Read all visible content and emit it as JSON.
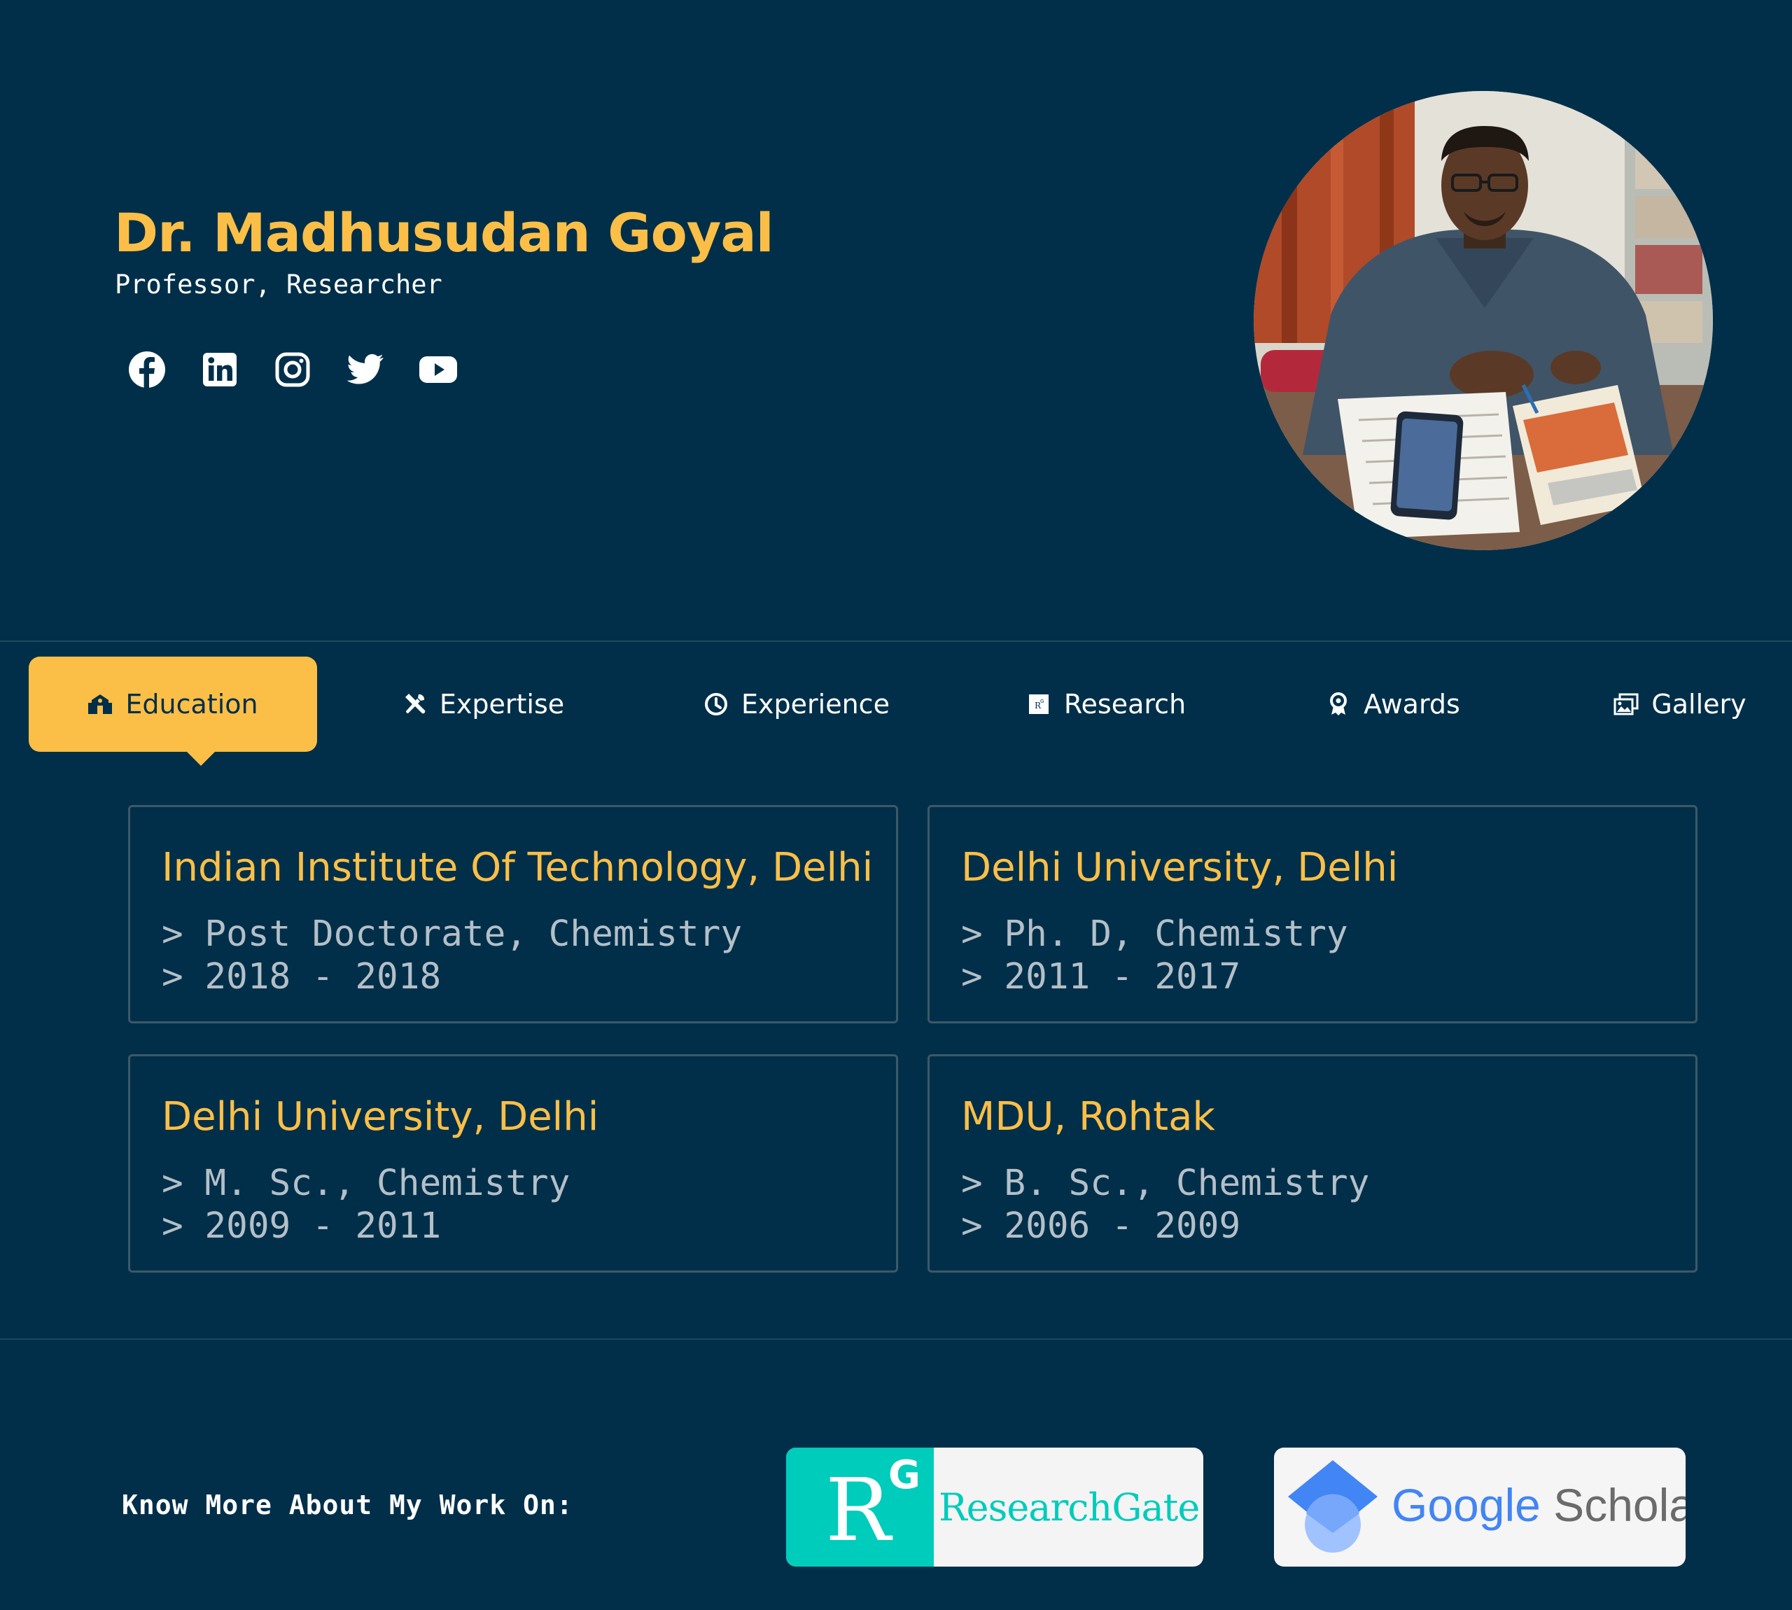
{
  "profile": {
    "name": "Dr. Madhusudan Goyal",
    "role": "Professor, Researcher",
    "photo_alt": "Profile photo"
  },
  "socials": [
    {
      "icon": "facebook-icon"
    },
    {
      "icon": "linkedin-icon"
    },
    {
      "icon": "instagram-icon"
    },
    {
      "icon": "twitter-icon"
    },
    {
      "icon": "youtube-icon"
    }
  ],
  "tabs": [
    {
      "label": "Education",
      "icon": "school-icon",
      "active": true
    },
    {
      "label": "Expertise",
      "icon": "tools-icon",
      "active": false
    },
    {
      "label": "Experience",
      "icon": "clock-icon",
      "active": false
    },
    {
      "label": "Research",
      "icon": "research-icon",
      "active": false
    },
    {
      "label": "Awards",
      "icon": "award-icon",
      "active": false
    },
    {
      "label": "Gallery",
      "icon": "gallery-icon",
      "active": false
    }
  ],
  "education": [
    {
      "institution": "Indian Institute Of Technology, Delhi",
      "degree": "> Post Doctorate, Chemistry",
      "years": "> 2018 - 2018"
    },
    {
      "institution": "Delhi University, Delhi",
      "degree": "> Ph. D, Chemistry",
      "years": "> 2011 - 2017"
    },
    {
      "institution": "Delhi University, Delhi",
      "degree": "> M. Sc., Chemistry",
      "years": "> 2009 - 2011"
    },
    {
      "institution": "MDU, Rohtak",
      "degree": "> B. Sc., Chemistry",
      "years": "> 2006 - 2009"
    }
  ],
  "footer": {
    "know_more": "Know More About My Work On:",
    "researchgate": {
      "mark_r": "R",
      "mark_g": "G",
      "label": "ResearchGate"
    },
    "scholar": {
      "google": "Google",
      "scholar": "Scholar"
    }
  },
  "colors": {
    "background": "#012f49",
    "accent": "#fbbf47",
    "muted_text": "#b4bfc8",
    "card_border": "#3d5868",
    "researchgate": "#00ccbb"
  }
}
